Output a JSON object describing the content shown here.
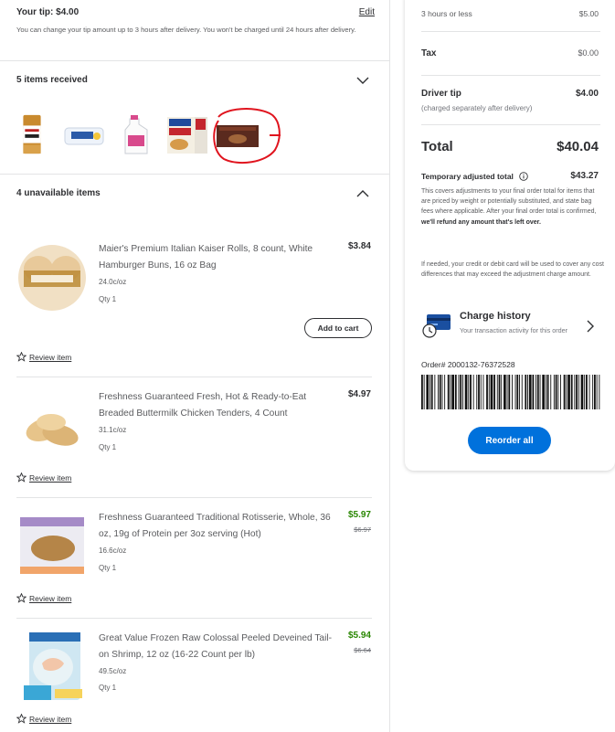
{
  "tip": {
    "title": "Your tip: $4.00",
    "edit_label": "Edit",
    "note": "You can change your tip amount up to 3 hours after delivery. You won't be charged until 24 hours after delivery."
  },
  "received": {
    "title": "5 items received",
    "icon": "chevron-down-icon"
  },
  "unavailable": {
    "title": "4 unavailable items",
    "icon": "chevron-up-icon",
    "items": [
      {
        "name": "Maier's Premium Italian Kaiser Rolls, 8 count, White Hamburger Buns, 16 oz Bag",
        "price": "$3.84",
        "was": "",
        "unit": "24.0c/oz",
        "qty": "Qty 1",
        "action": "Add to cart",
        "review": "Review item"
      },
      {
        "name": "Freshness Guaranteed Fresh, Hot & Ready-to-Eat Breaded Buttermilk Chicken Tenders, 4 Count",
        "price": "$4.97",
        "was": "",
        "unit": "31.1c/oz",
        "qty": "Qty 1",
        "review": "Review item"
      },
      {
        "name": "Freshness Guaranteed Traditional Rotisserie, Whole, 36 oz, 19g of Protein per 3oz serving (Hot)",
        "price": "$5.97",
        "was": "$6.97",
        "unit": "16.6c/oz",
        "qty": "Qty 1",
        "review": "Review item"
      },
      {
        "name": "Great Value Frozen Raw Colossal Peeled Deveined Tail-on Shrimp, 12 oz (16-22 Count per lb)",
        "price": "$5.94",
        "was": "$6.64",
        "unit": "49.5c/oz",
        "qty": "Qty 1",
        "review": "Review item"
      }
    ]
  },
  "summary": {
    "fee_label": "3 hours or less",
    "fee_value": "$5.00",
    "tax_label": "Tax",
    "tax_value": "$0.00",
    "tip_label": "Driver tip",
    "tip_value": "$4.00",
    "tip_sub": "(charged separately after delivery)",
    "total_label": "Total",
    "total_value": "$40.04",
    "temp_label": "Temporary adjusted total",
    "temp_value": "$43.27",
    "temp_note_a": "This covers adjustments to your final order total for items that are priced by weight or potentially substituted, and state bag fees where applicable. After your final order total is confirmed,",
    "temp_note_b": "we'll refund any amount that's left over.",
    "card_note": "If needed, your credit or debit card will be used to cover any cost differences that may exceed the adjustment charge amount.",
    "charge_title": "Charge history",
    "charge_sub": "Your transaction activity for this order",
    "order_number": "Order# 2000132-76372528",
    "reorder_label": "Reorder all"
  },
  "colors": {
    "accent": "#0071dc",
    "sale_green": "#2a8703",
    "annotation_red": "#e0141e"
  }
}
